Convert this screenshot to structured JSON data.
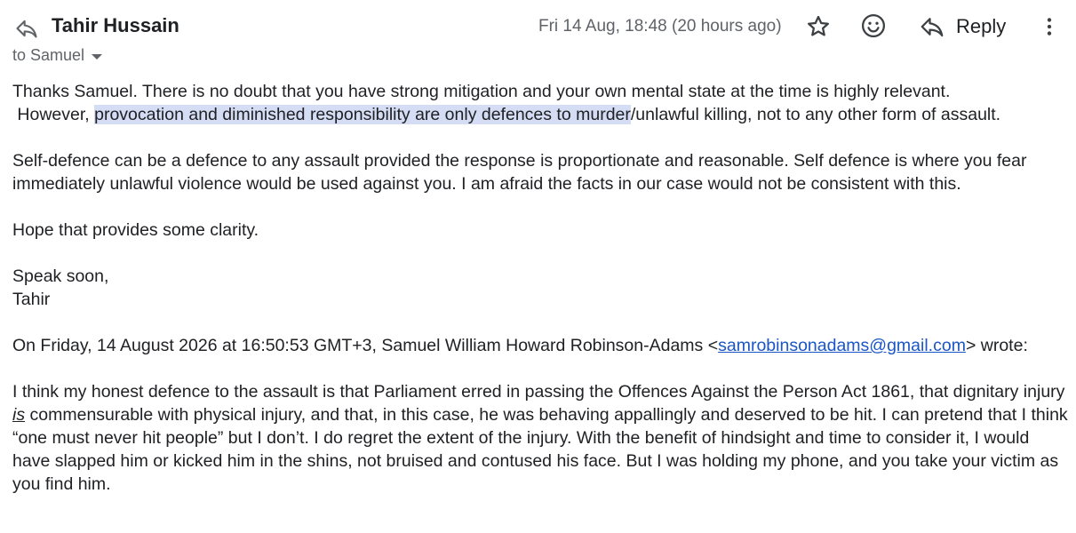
{
  "header": {
    "sender": "Tahir Hussain",
    "to_label": "to Samuel",
    "date": "Fri 14 Aug, 18:48 (20 hours ago)",
    "reply_label": "Reply"
  },
  "body": {
    "p1_line1": "Thanks Samuel.  There is no doubt that you have strong mitigation and your own mental state at the time is highly relevant.",
    "p1_line2_pre": " However, ",
    "p1_line2_highlight": "provocation and diminished responsibility are only defences to murder",
    "p1_line2_post": "/unlawful killing, not to any other form of assault.",
    "p2": "Self-defence can be  a defence to any assault provided the response is proportionate and reasonable.  Self defence is where you fear immediately unlawful violence would be used against you. I am afraid the facts in our case would not be consistent with this.",
    "p3": "Hope that provides some clarity.",
    "signoff": "Speak soon,",
    "signature": "Tahir",
    "quote_header_pre": "On Friday, 14 August 2026 at 16:50:53 GMT+3, Samuel William Howard Robinson-Adams <",
    "quote_email": "samrobinsonadams@gmail.com",
    "quote_header_post": "> wrote:",
    "quoted_pre": "I think my honest defence to the assault is that Parliament erred in passing the Offences Against the Person Act 1861, that dignitary injury ",
    "quoted_emph": "is",
    "quoted_post": " commensurable with physical injury, and that, in this case, he was behaving appallingly and deserved to be hit. I can pretend that I think “one must never hit people” but I don’t. I do regret the extent of the injury. With the benefit of hindsight and time to consider it, I would have slapped him or kicked him in the shins, not bruised and contused his face. But I was holding my phone, and you take your victim as you find him."
  },
  "icons": [
    "reply-arrow-icon",
    "star-icon",
    "emoji-icon",
    "reply-icon",
    "more-vert-icon",
    "dropdown-caret-icon"
  ],
  "colors": {
    "link": "#1a56c7",
    "highlight": "#d5ddf5",
    "muted": "#5f6368"
  }
}
